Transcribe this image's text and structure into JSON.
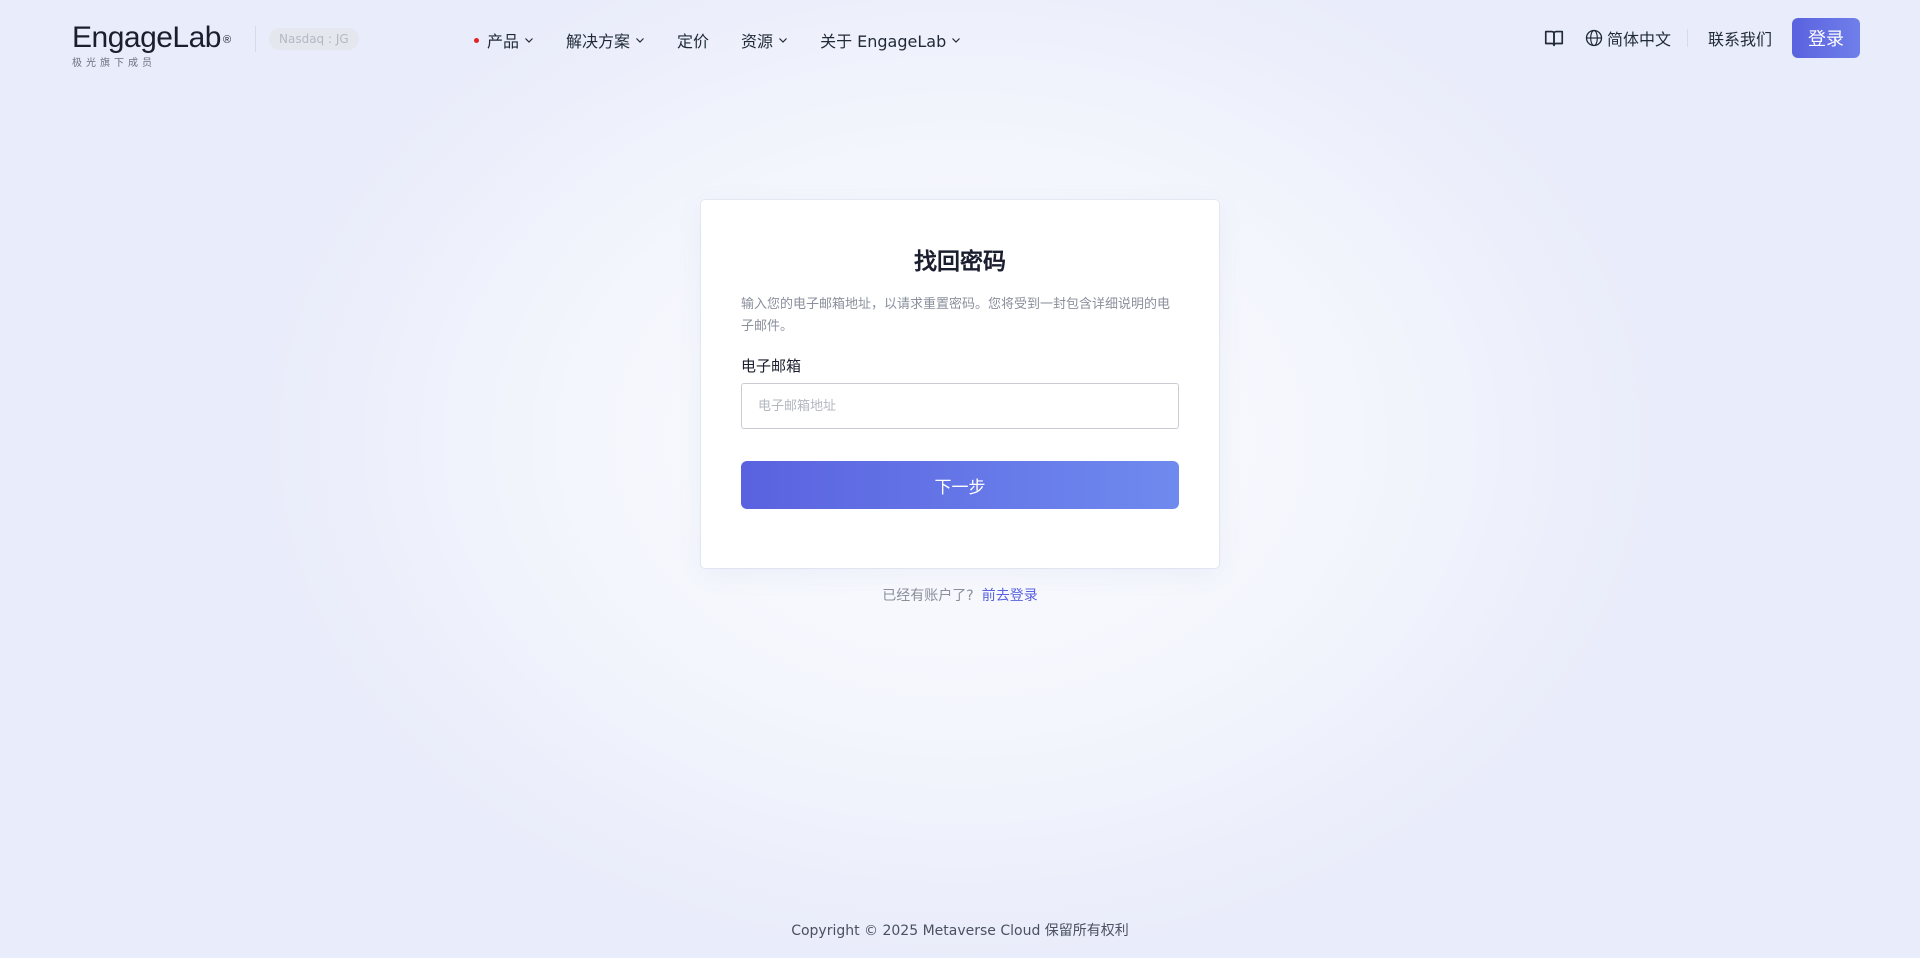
{
  "header": {
    "logo_text": "EngageLab",
    "logo_reg": "®",
    "logo_subtitle": "极光旗下成员",
    "badge": "Nasdaq : JG",
    "nav": [
      {
        "label": "产品",
        "dot": true,
        "dropdown": true
      },
      {
        "label": "解决方案",
        "dropdown": true
      },
      {
        "label": "定价",
        "dropdown": false
      },
      {
        "label": "资源",
        "dropdown": true
      },
      {
        "label": "关于 EngageLab",
        "dropdown": true
      }
    ],
    "language": "简体中文",
    "contact": "联系我们",
    "login": "登录"
  },
  "form": {
    "title": "找回密码",
    "description": "输入您的电子邮箱地址，以请求重置密码。您将受到一封包含详细说明的电子邮件。",
    "email_label": "电子邮箱",
    "email_placeholder": "电子邮箱地址",
    "email_value": "",
    "submit": "下一步"
  },
  "login_hint": {
    "text": "已经有账户了?",
    "link": "前去登录"
  },
  "footer": {
    "copyright": "Copyright © 2025 Metaverse Cloud 保留所有权利"
  },
  "colors": {
    "accent": "#5a62df",
    "accent_light": "#6f8aef",
    "nav_dot": "#e02424"
  },
  "icons": {
    "docs": "book-icon",
    "language": "globe-icon",
    "dropdown": "chevron-down-icon"
  }
}
